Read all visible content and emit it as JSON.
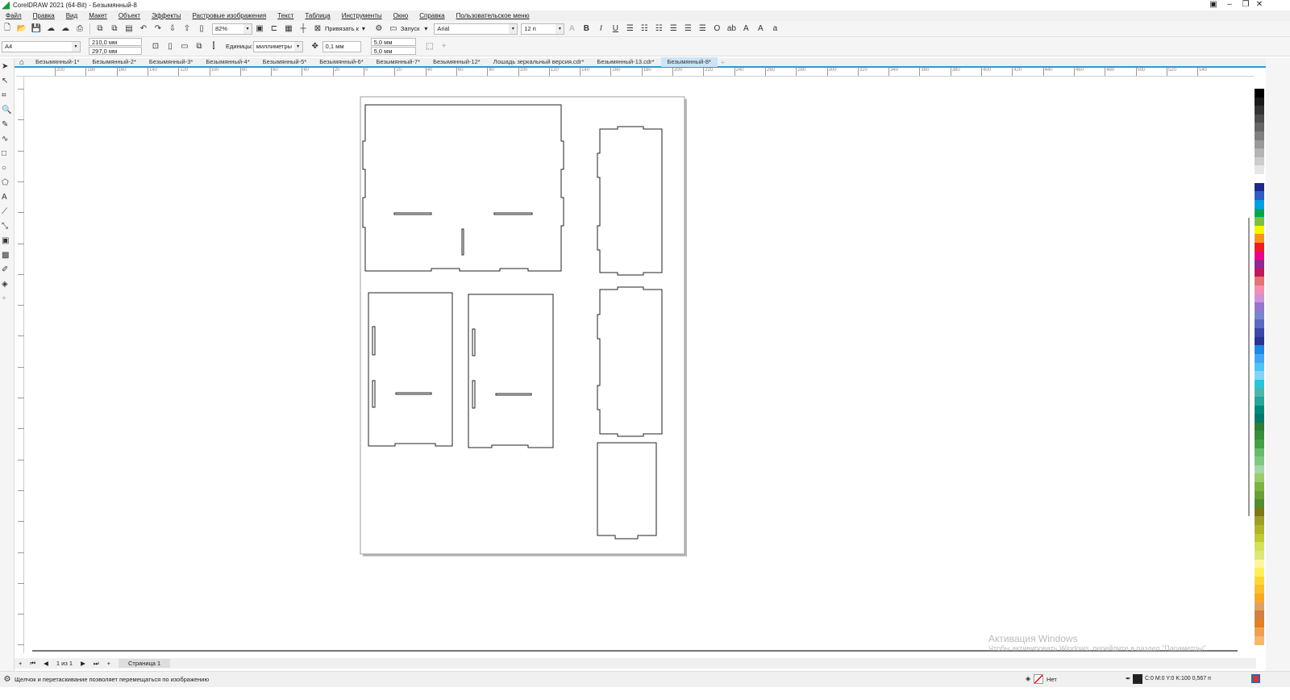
{
  "window": {
    "title": "CorelDRAW 2021 (64-Bit) - Безымянный-8"
  },
  "menu": [
    "Файл",
    "Правка",
    "Вид",
    "Макет",
    "Объект",
    "Эффекты",
    "Растровые изображения",
    "Текст",
    "Таблица",
    "Инструменты",
    "Окно",
    "Справка",
    "Пользовательское меню"
  ],
  "toolbar": {
    "zoom": "82%",
    "snap_label": "Привязать к",
    "launch_label": "Запуск",
    "font": "Arial",
    "font_size": "12 п"
  },
  "propbar": {
    "page_size": "A4",
    "width": "210,0 мм",
    "height": "297,0 мм",
    "units_label": "Единицы:",
    "units": "миллиметры",
    "nudge": "0,1 мм",
    "dup_x": "5,0 мм",
    "dup_y": "5,0 мм"
  },
  "tabs": [
    {
      "label": "Безымянный-1*"
    },
    {
      "label": "Безымянный-2*"
    },
    {
      "label": "Безымянный-3*"
    },
    {
      "label": "Безымянный-4*"
    },
    {
      "label": "Безымянный-5*"
    },
    {
      "label": "Безымянный-6*"
    },
    {
      "label": "Безымянный-7*"
    },
    {
      "label": "Безымянный-12*"
    },
    {
      "label": "Лошадь зеркальный версия.cdr*"
    },
    {
      "label": "Безымянный-13.cdr*"
    },
    {
      "label": "Безымянный-8*",
      "active": true
    }
  ],
  "ruler": {
    "top_labels": [
      "200",
      "180",
      "160",
      "140",
      "120",
      "100",
      "80",
      "60",
      "40",
      "20",
      "0",
      "20",
      "40",
      "60",
      "80",
      "100",
      "120",
      "140",
      "160",
      "180",
      "200",
      "220",
      "240",
      "260",
      "280",
      "300",
      "320",
      "340",
      "360",
      "380",
      "400",
      "420",
      "440",
      "460",
      "480",
      "500",
      "520",
      "540"
    ],
    "unit": "миллиметры"
  },
  "pagebar": {
    "count": "1 из 1",
    "page": "Страница 1"
  },
  "status": {
    "hint": "Щелчок и перетаскивание позволяет перемещаться по изображению",
    "fill": "Нет",
    "outline": "C:0 M:0 Y:0 K:100  0,567 п"
  },
  "watermark": {
    "title": "Активация Windows",
    "text": "Чтобы активировать Windows, перейдите в раздел \"Параметры\"."
  },
  "colors": {
    "accent": "#2a9bd8",
    "palette": [
      "#000000",
      "#1a1a1a",
      "#333333",
      "#4d4d4d",
      "#666666",
      "#808080",
      "#999999",
      "#b3b3b3",
      "#cccccc",
      "#e6e6e6",
      "#ffffff",
      "#1c2a8c",
      "#2e5cc7",
      "#00a0e0",
      "#00a651",
      "#7ac143",
      "#fff200",
      "#f7941d",
      "#ed1c24",
      "#ec008c",
      "#92278f",
      "#c2185b",
      "#e57373",
      "#f48fb1",
      "#ce93d8",
      "#9575cd",
      "#7986cb",
      "#5c6bc0",
      "#3949ab",
      "#283593",
      "#1e88e5",
      "#42a5f5",
      "#4fc3f7",
      "#81d4fa",
      "#26c6da",
      "#4db6ac",
      "#26a69a",
      "#00897b",
      "#00796b",
      "#2e7d32",
      "#388e3c",
      "#43a047",
      "#66bb6a",
      "#81c784",
      "#a5d6a7",
      "#9ccc65",
      "#7cb342",
      "#689f38",
      "#558b2f",
      "#827717",
      "#9e9d24",
      "#afb42b",
      "#c0ca33",
      "#d4e157",
      "#dce775",
      "#fff59d",
      "#ffee58",
      "#fdd835",
      "#fbc02d",
      "#f9a825",
      "#e0a060",
      "#d08040",
      "#e67e22",
      "#f0a050",
      "#f5b870"
    ]
  }
}
